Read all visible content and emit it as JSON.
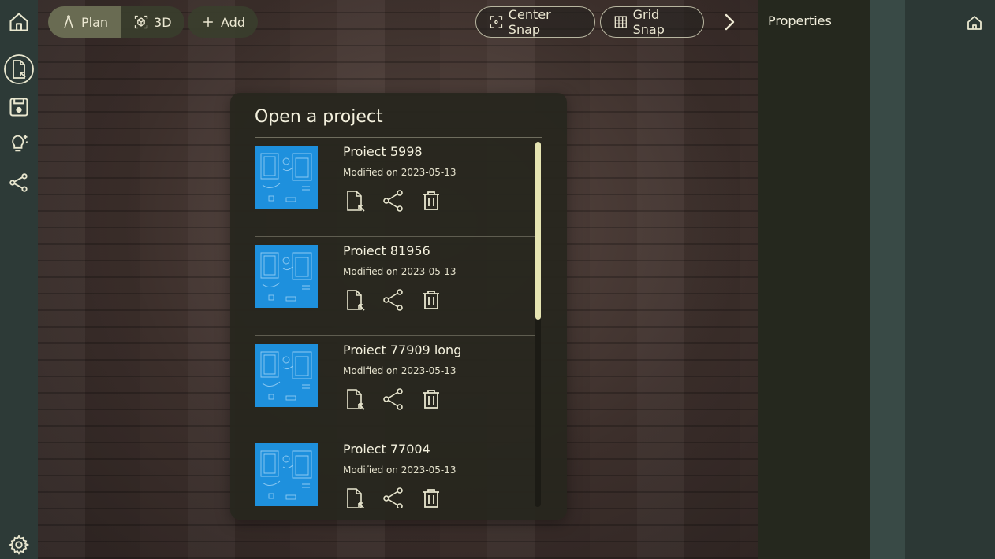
{
  "toolbar": {
    "plan_label": "Plan",
    "view3d_label": "3D",
    "add_label": "Add",
    "center_snap_label": "Center Snap",
    "grid_snap_label": "Grid Snap"
  },
  "sidebar": {
    "items": [
      "home-icon",
      "open-file-icon",
      "save-icon",
      "lightbulb-sparkle-icon",
      "share-icon"
    ],
    "bottom": "gear-icon"
  },
  "properties": {
    "title": "Properties"
  },
  "dialog": {
    "title": "Open a project",
    "scroll_fraction_visible": 0.49,
    "projects": [
      {
        "name": "Proiect 5998",
        "modified": "Modified on 2023-05-13"
      },
      {
        "name": "Proiect 81956",
        "modified": "Modified on 2023-05-13"
      },
      {
        "name": "Proiect 77909 long",
        "modified": "Modified on 2023-05-13"
      },
      {
        "name": "Proiect 77004",
        "modified": "Modified on 2023-05-13"
      }
    ]
  },
  "colors": {
    "accent": "#e6e4b2",
    "thumbnail": "#1e90dd",
    "rail": "#2d3a37",
    "panel": "#25281e"
  }
}
